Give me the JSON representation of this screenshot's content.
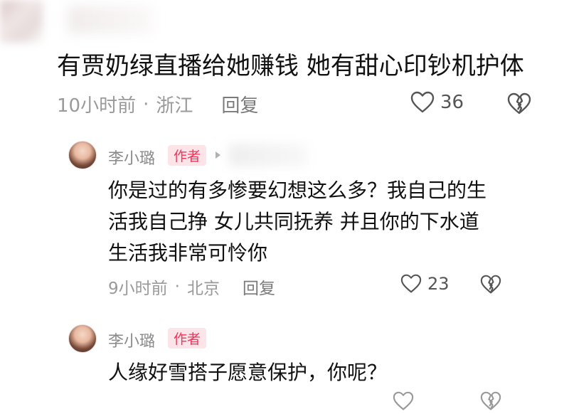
{
  "comment": {
    "text": "有贾奶绿直播给她赚钱 她有甜心印钞机护体",
    "time": "10小时前",
    "location": "浙江",
    "reply_label": "回复",
    "likes": "36"
  },
  "replies": [
    {
      "author": "李小璐",
      "badge": "作者",
      "text": "你是过的有多惨要幻想这么多？我自己的生\n活我自己挣 女儿共同抚养 并且你的下水道\n生活我非常可怜你",
      "time": "9小时前",
      "location": "北京",
      "reply_label": "回复",
      "likes": "23"
    },
    {
      "author": "李小璐",
      "badge": "作者",
      "text": "人缘好雪搭子愿意保护，你呢？"
    }
  ],
  "icons": {
    "like": "heart-outline-icon",
    "dislike": "broken-heart-icon",
    "reply_to": "triangle-right-icon"
  },
  "colors": {
    "badge_bg": "#fde4e8",
    "badge_text": "#f0355a",
    "meta": "#9a9a9a"
  }
}
